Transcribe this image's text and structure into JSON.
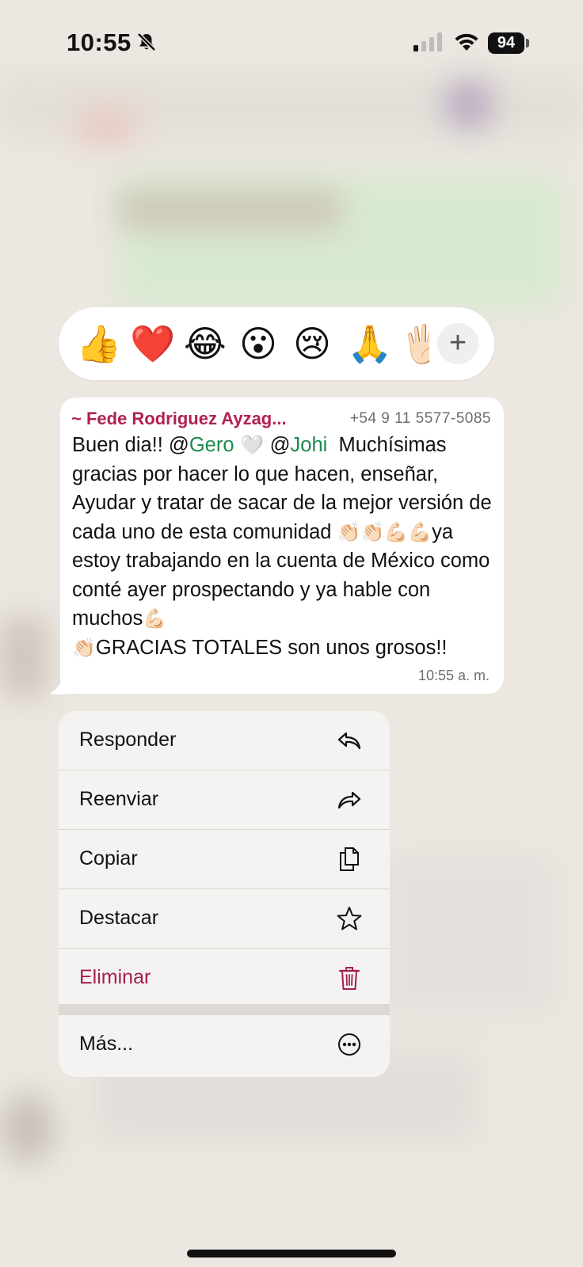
{
  "status_bar": {
    "time": "10:55",
    "battery": "94"
  },
  "reactions": [
    {
      "emoji": "👍",
      "name": "thumbs-up"
    },
    {
      "emoji": "❤️",
      "name": "heart"
    },
    {
      "emoji": "😂",
      "name": "laughing"
    },
    {
      "emoji": "😮",
      "name": "surprised"
    },
    {
      "emoji": "😢",
      "name": "crying"
    },
    {
      "emoji": "🙏",
      "name": "praying-hands"
    },
    {
      "emoji": "🖐🏻",
      "name": "raised-hand"
    }
  ],
  "reaction_more": "+",
  "message": {
    "sender": "~ Fede Rodriguez Ayzag...",
    "phone": "+54 9 11 5577-5085",
    "text_1": "Buen dia!! ",
    "mention_1_at": "@",
    "mention_1": "Gero",
    "heart": " 🤍 ",
    "mention_2_at": "@",
    "mention_2": "Johi",
    "text_2": "  Muchísimas gracias por hacer lo que hacen, enseñar, Ayudar y tratar de sacar de la mejor versión de cada uno de esta comunidad ",
    "emojis_1": "👏🏻👏🏻💪🏻💪🏻",
    "text_3": "ya estoy trabajando en la cuenta de México como conté ayer prospectando y ya hable con muchos",
    "emojis_2": "💪🏻",
    "emojis_3": "👏🏻",
    "text_4": "GRACIAS TOTALES son unos grosos!!",
    "time": "10:55 a. m."
  },
  "menu": {
    "items": [
      {
        "label": "Responder",
        "icon": "reply-icon"
      },
      {
        "label": "Reenviar",
        "icon": "forward-icon"
      },
      {
        "label": "Copiar",
        "icon": "copy-icon"
      },
      {
        "label": "Destacar",
        "icon": "star-icon"
      },
      {
        "label": "Eliminar",
        "icon": "trash-icon",
        "color": "#a3204a"
      }
    ],
    "more": {
      "label": "Más...",
      "icon": "more-icon"
    }
  }
}
